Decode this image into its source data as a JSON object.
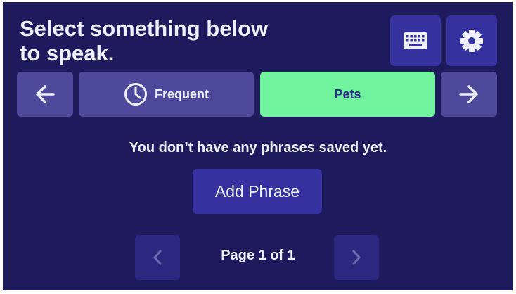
{
  "header": {
    "title_line1": "Select something below",
    "title_line2": "to speak."
  },
  "toolbar": {
    "keyboard_icon": "keyboard-icon",
    "settings_icon": "gear-icon"
  },
  "tabs": {
    "prev_icon": "arrow-left-icon",
    "next_icon": "arrow-right-icon",
    "items": [
      {
        "label": "Frequent",
        "icon": "clock-icon",
        "selected": false
      },
      {
        "label": "Pets",
        "selected": true
      }
    ]
  },
  "main": {
    "empty_message": "You don’t have any phrases saved yet.",
    "add_label": "Add Phrase"
  },
  "pagination": {
    "label": "Page 1 of 1",
    "current": 1,
    "total": 1
  },
  "colors": {
    "background": "#1e1b5c",
    "button": "#3532a0",
    "tab_inactive": "#4d4a9c",
    "tab_active": "#71f29d",
    "text": "#eef0ff"
  }
}
